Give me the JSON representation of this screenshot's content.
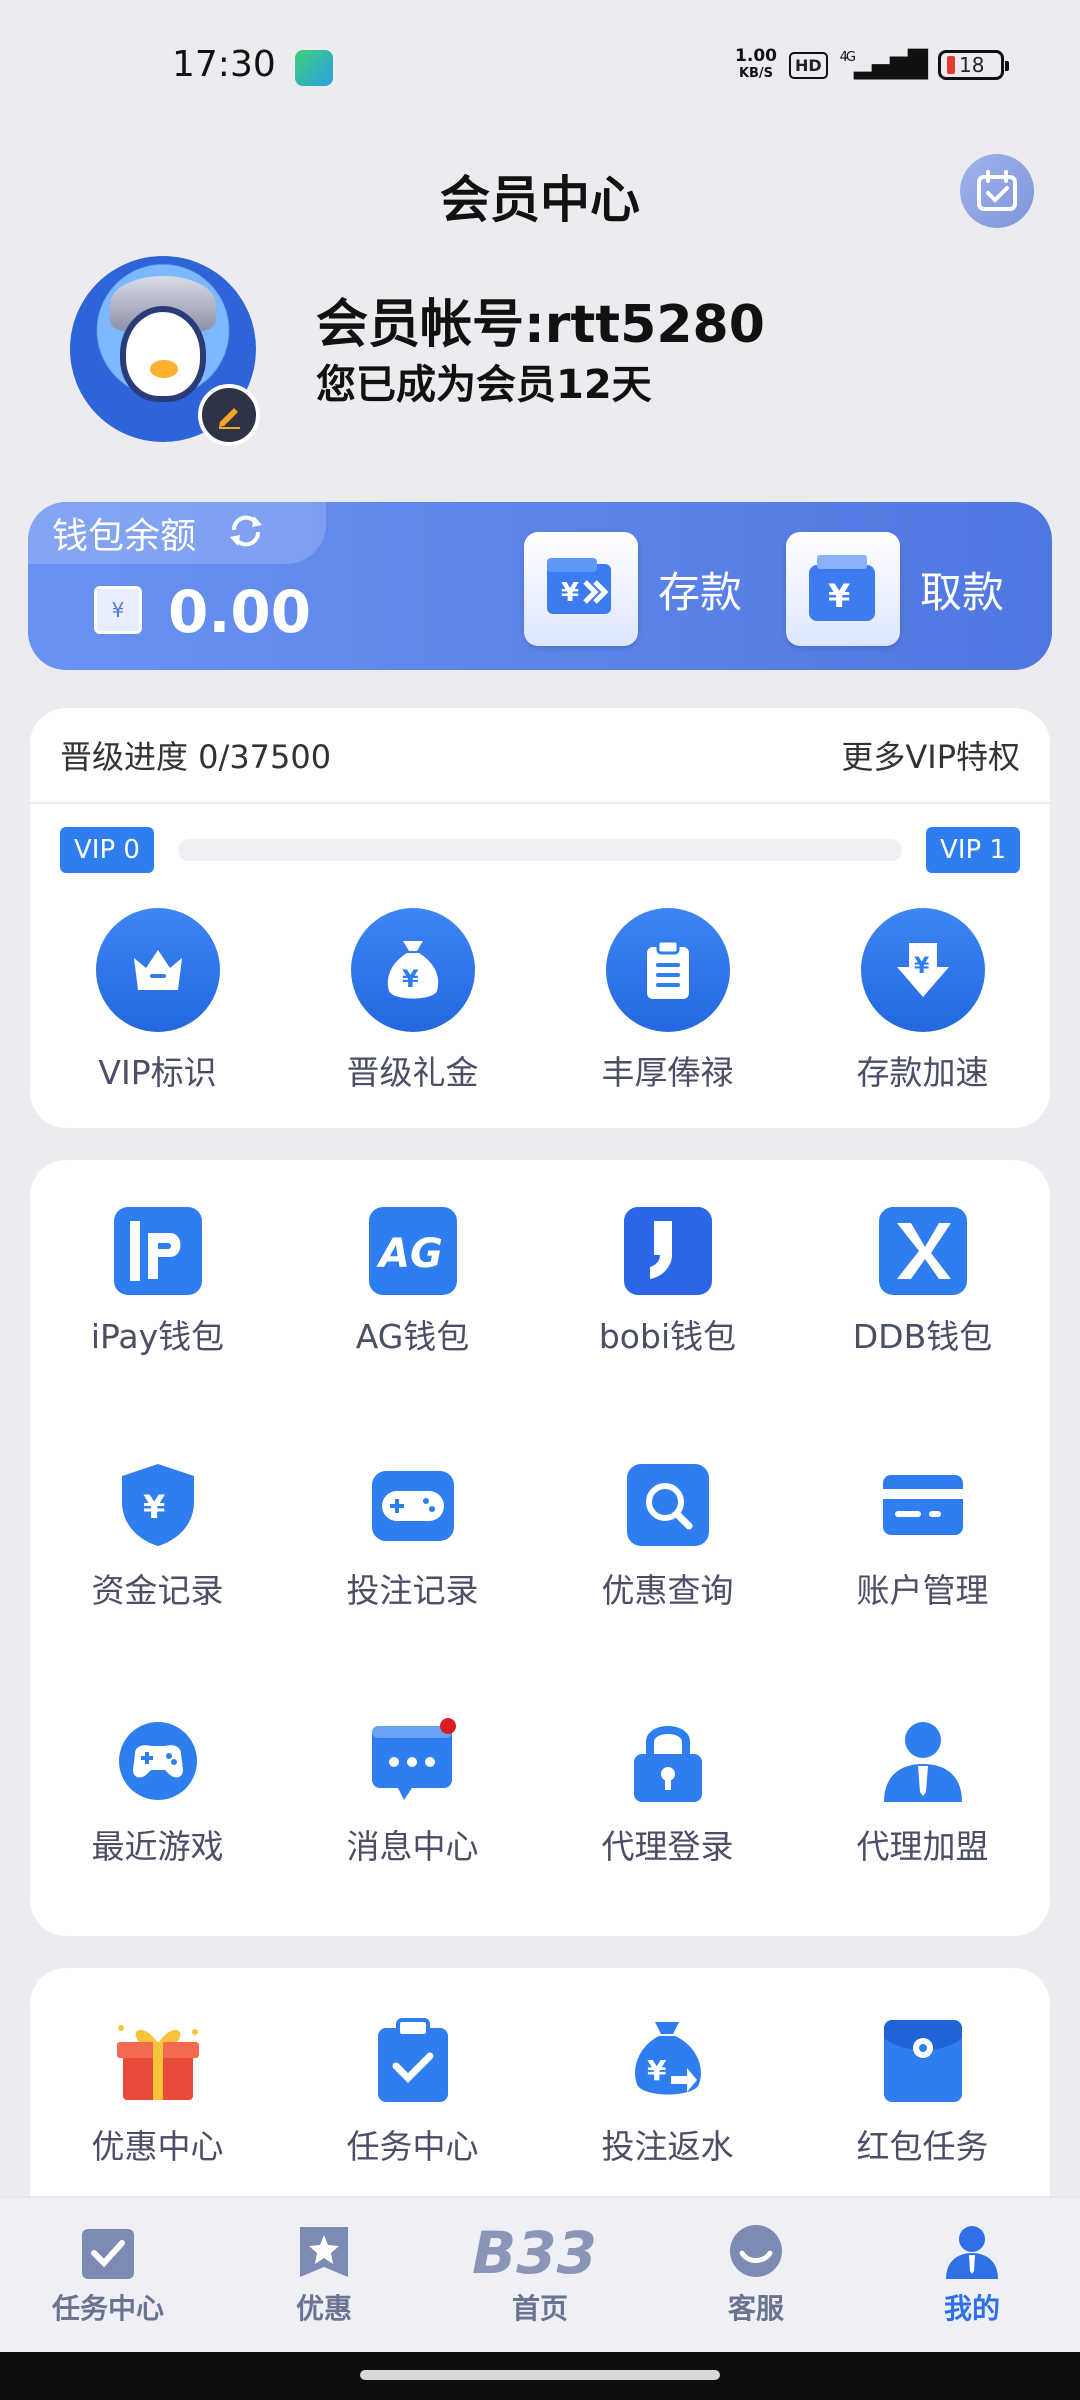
{
  "status_bar": {
    "time": "17:30",
    "speed_value": "1.00",
    "speed_unit": "KB/S",
    "hd": "HD",
    "network": "4G",
    "battery": "18"
  },
  "header": {
    "title": "会员中心",
    "calendar_icon": "calendar-check-icon"
  },
  "profile": {
    "account": "会员帐号:rtt5280",
    "membership_days": "您已成为会员12天"
  },
  "wallet": {
    "label": "钱包余额",
    "balance": "0.00",
    "currency_glyph": "¥",
    "deposit_label": "存款",
    "withdraw_label": "取款",
    "accent": "#5a82e8"
  },
  "vip": {
    "progress_label": "晋级进度 0/37500",
    "progress_fraction": 0,
    "more_label": "更多VIP特权",
    "from_level": "VIP 0",
    "to_level": "VIP 1",
    "perks": [
      {
        "label": "VIP标识",
        "icon": "crown-icon"
      },
      {
        "label": "晋级礼金",
        "icon": "money-bag-icon"
      },
      {
        "label": "丰厚俸禄",
        "icon": "clipboard-icon"
      },
      {
        "label": "存款加速",
        "icon": "deposit-download-icon"
      }
    ]
  },
  "tools": [
    {
      "label": "iPay钱包",
      "icon": "ipay-logo-icon"
    },
    {
      "label": "AG钱包",
      "icon": "ag-logo-icon"
    },
    {
      "label": "bobi钱包",
      "icon": "bobi-logo-icon"
    },
    {
      "label": "DDB钱包",
      "icon": "ddb-logo-icon"
    },
    {
      "label": "资金记录",
      "icon": "yuan-shield-icon"
    },
    {
      "label": "投注记录",
      "icon": "gamepad-icon"
    },
    {
      "label": "优惠查询",
      "icon": "search-icon"
    },
    {
      "label": "账户管理",
      "icon": "card-icon"
    },
    {
      "label": "最近游戏",
      "icon": "controller-icon"
    },
    {
      "label": "消息中心",
      "icon": "message-icon"
    },
    {
      "label": "代理登录",
      "icon": "lock-icon"
    },
    {
      "label": "代理加盟",
      "icon": "agent-icon"
    }
  ],
  "promos": [
    {
      "label": "优惠中心",
      "icon": "gift-icon"
    },
    {
      "label": "任务中心",
      "icon": "task-clipboard-icon"
    },
    {
      "label": "投注返水",
      "icon": "rebate-bag-icon"
    },
    {
      "label": "红包任务",
      "icon": "red-envelope-icon"
    }
  ],
  "bottom_nav": [
    {
      "label": "任务中心",
      "icon": "task-icon"
    },
    {
      "label": "优惠",
      "icon": "star-badge-icon"
    },
    {
      "label": "首页",
      "icon": "b33-logo-icon",
      "logo_text": "B33"
    },
    {
      "label": "客服",
      "icon": "support-icon"
    },
    {
      "label": "我的",
      "icon": "user-icon",
      "active": true
    }
  ],
  "colors": {
    "primary": "#2f6fe8",
    "icon_blue": "#2f7ef0",
    "notification": "#d81e1e"
  }
}
